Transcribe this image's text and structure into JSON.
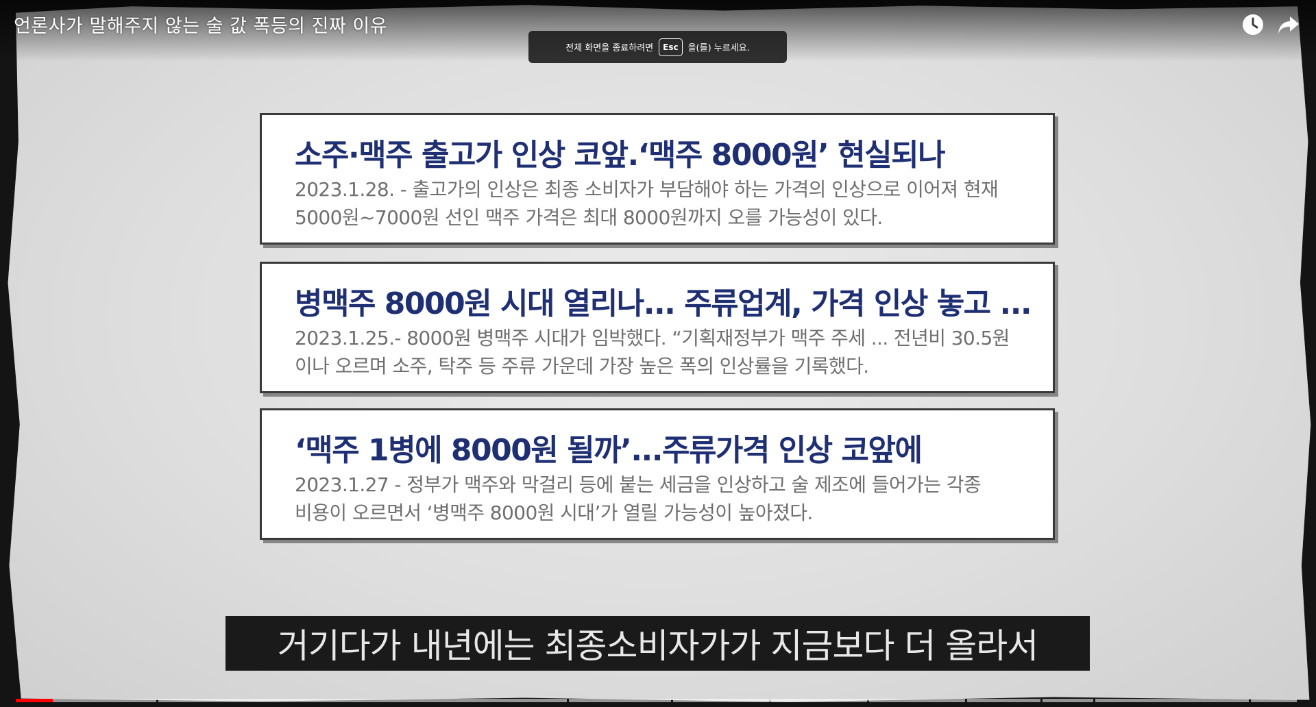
{
  "video": {
    "title": "언론사가 말해주지 않는 술 값 폭등의 진짜 이유",
    "watch_later_icon": "clock-icon",
    "share_icon": "share-icon"
  },
  "toast": {
    "before": "전체 화면을 종료하려면",
    "key": "Esc",
    "after": "을(를) 누르세요."
  },
  "articles": [
    {
      "headline": "소주·맥주  출고가 인상 코앞.‘맥주 8000원’ 현실되나",
      "line1": "2023.1.28. - 출고가의 인상은 최종 소비자가 부담해야 하는 가격의 인상으로 이어져 현재",
      "line2": "5000원~7000원 선인 맥주 가격은 최대 8000원까지 오를 가능성이 있다."
    },
    {
      "headline": "병맥주 8000원 시대 열리나... 주류업계, 가격 인상 놓고 ...",
      "line1": "2023.1.25.- 8000원 병맥주 시대가 임박했다. “기획재정부가 맥주 주세 ... 전년비 30.5원",
      "line2": "이나 오르며 소주, 탁주 등 주류 가운데 가장 높은 폭의 인상률을 기록했다."
    },
    {
      "headline": "‘맥주 1병에 8000원 될까’...주류가격 인상 코앞에",
      "line1": "2023.1.27 - 정부가 맥주와 막걸리 등에 붙는 세금을 인상하고 술 제조에 들어가는 각종",
      "line2": "비용이 오르면서 ‘병맥주 8000원 시대’가 열릴 가능성이 높아졌다."
    }
  ],
  "subtitle": "거기다가 내년에는 최종소비자가가 지금보다 더 올라서",
  "progress": {
    "played_fraction": 0.029,
    "played_color": "#ff0000",
    "chapter_count": 11
  },
  "colors": {
    "headline": "#1f2f73",
    "body": "#6f6f6f"
  }
}
